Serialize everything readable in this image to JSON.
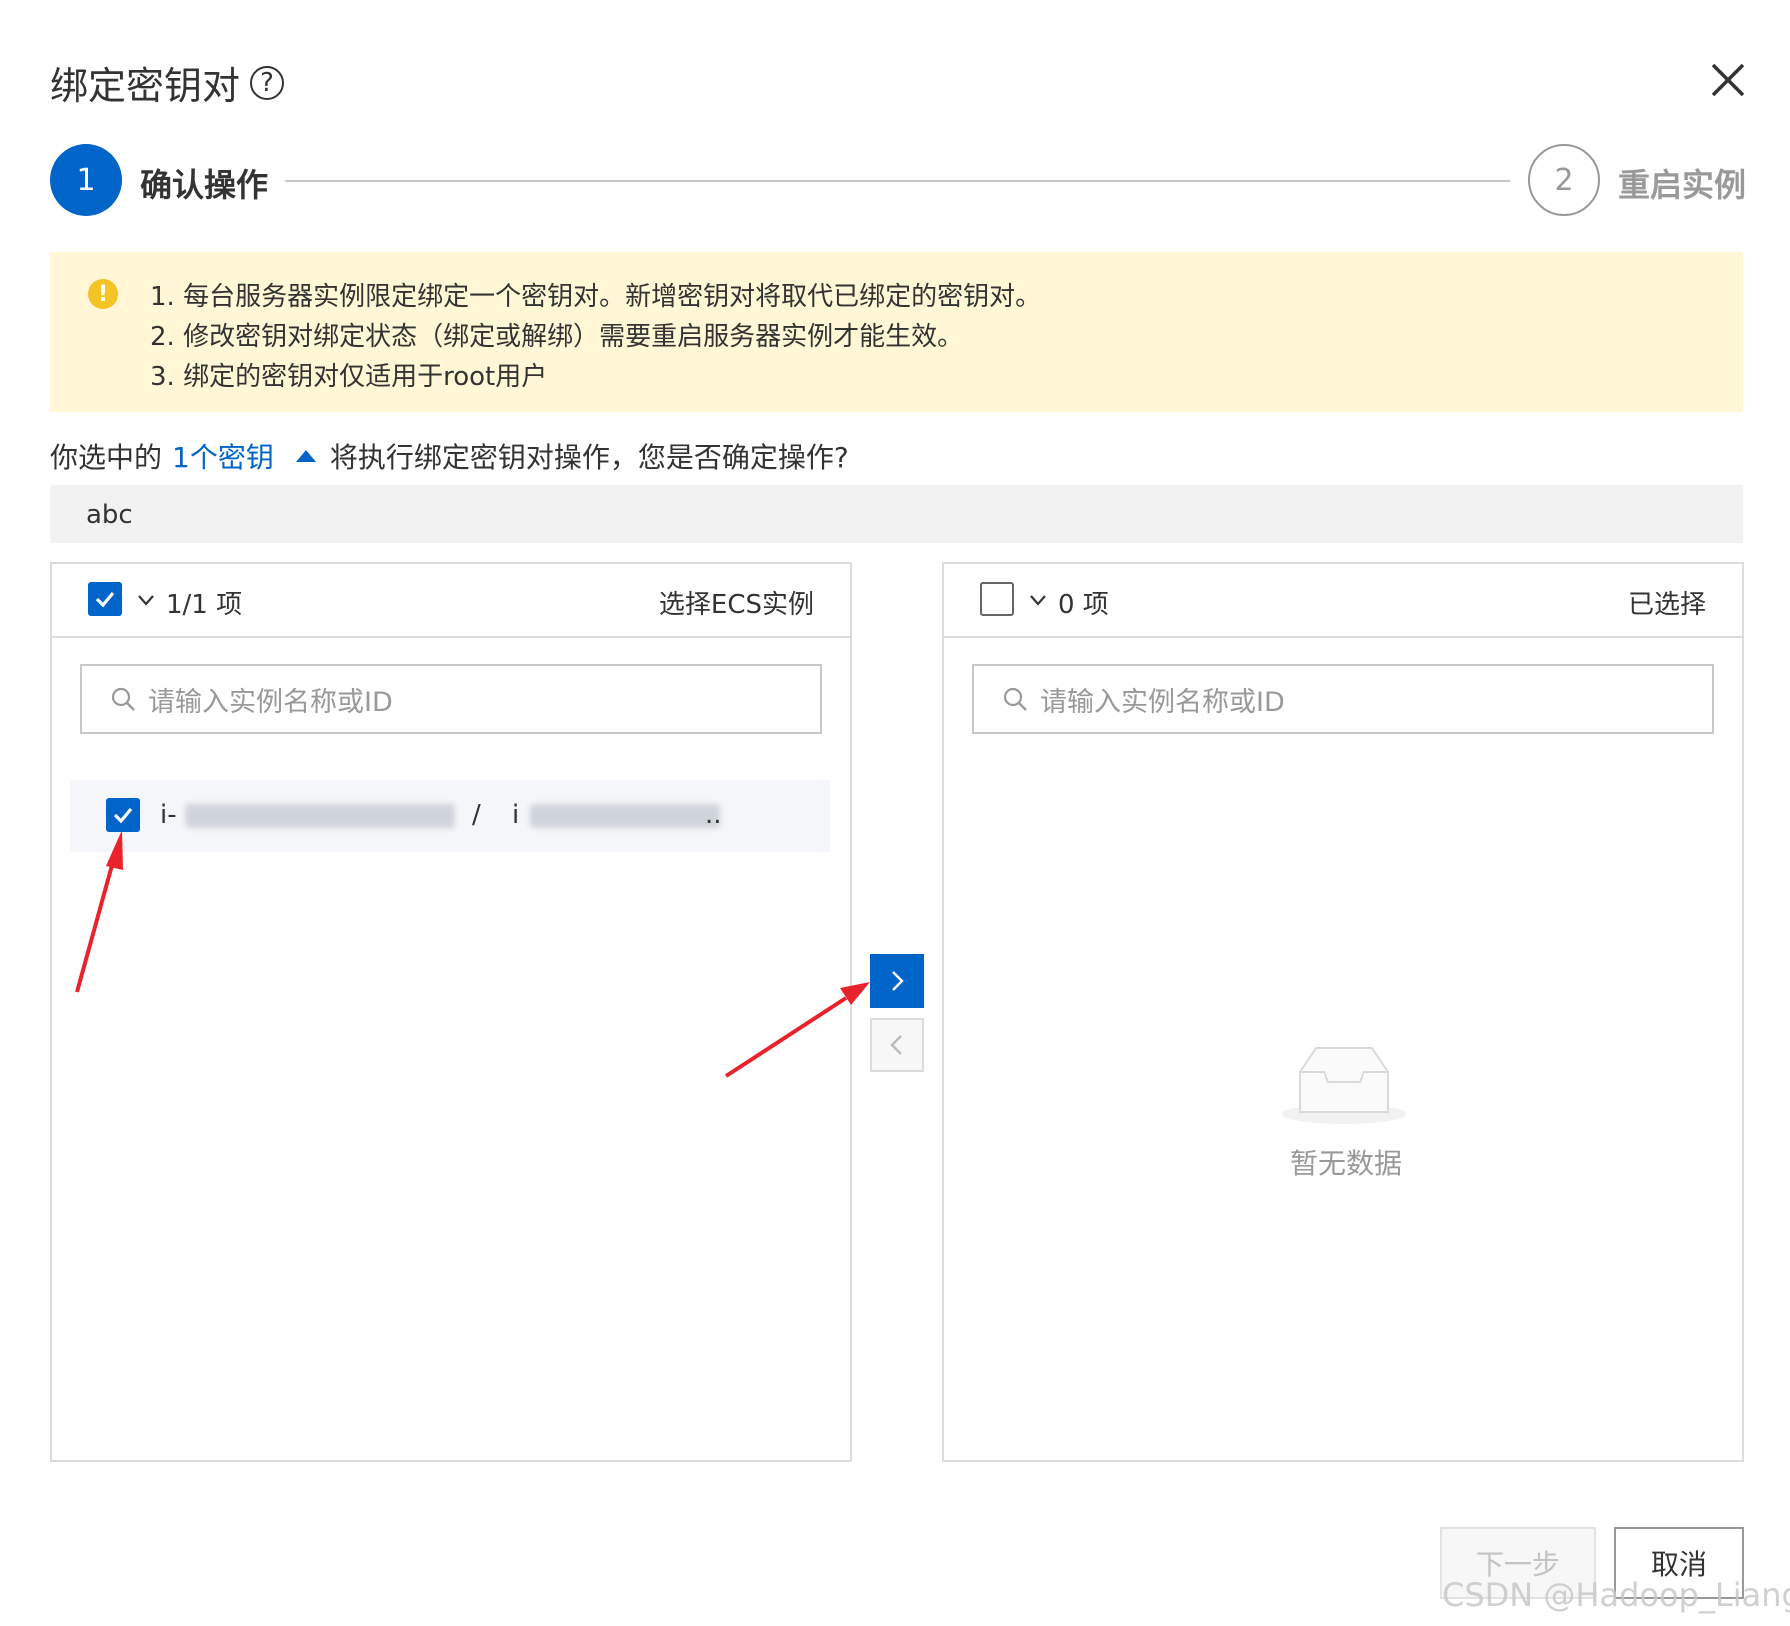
{
  "dialog": {
    "title": "绑定密钥对",
    "help_glyph": "?"
  },
  "steps": [
    {
      "number": "1",
      "label": "确认操作",
      "active": true
    },
    {
      "number": "2",
      "label": "重启实例",
      "active": false
    }
  ],
  "notice": {
    "icon": "!",
    "lines": [
      "1. 每台服务器实例限定绑定一个密钥对。新增密钥对将取代已绑定的密钥对。",
      "2. 修改密钥对绑定状态（绑定或解绑）需要重启服务器实例才能生效。",
      "3. 绑定的密钥对仅适用于root用户"
    ]
  },
  "confirm": {
    "prefix": "你选中的",
    "link": "1个密钥",
    "suffix": "将执行绑定密钥对操作，您是否确定操作?",
    "key_name": "abc"
  },
  "left_panel": {
    "count": "1/1 项",
    "title": "选择ECS实例",
    "search_placeholder": "请输入实例名称或ID",
    "items": [
      {
        "id_prefix": "i-",
        "separator": "/",
        "name_prefix": "i",
        "ellipsis": "..",
        "checked": true
      }
    ]
  },
  "right_panel": {
    "count": "0 项",
    "title": "已选择",
    "search_placeholder": "请输入实例名称或ID",
    "empty_text": "暂无数据"
  },
  "footer": {
    "next_label": "下一步",
    "cancel_label": "取消"
  },
  "watermark": "CSDN @Hadoop_Liang",
  "colors": {
    "primary": "#0064c8",
    "annotation_arrow": "#e8232b",
    "notice_bg": "#fff7d6",
    "warning": "#f6c324"
  }
}
